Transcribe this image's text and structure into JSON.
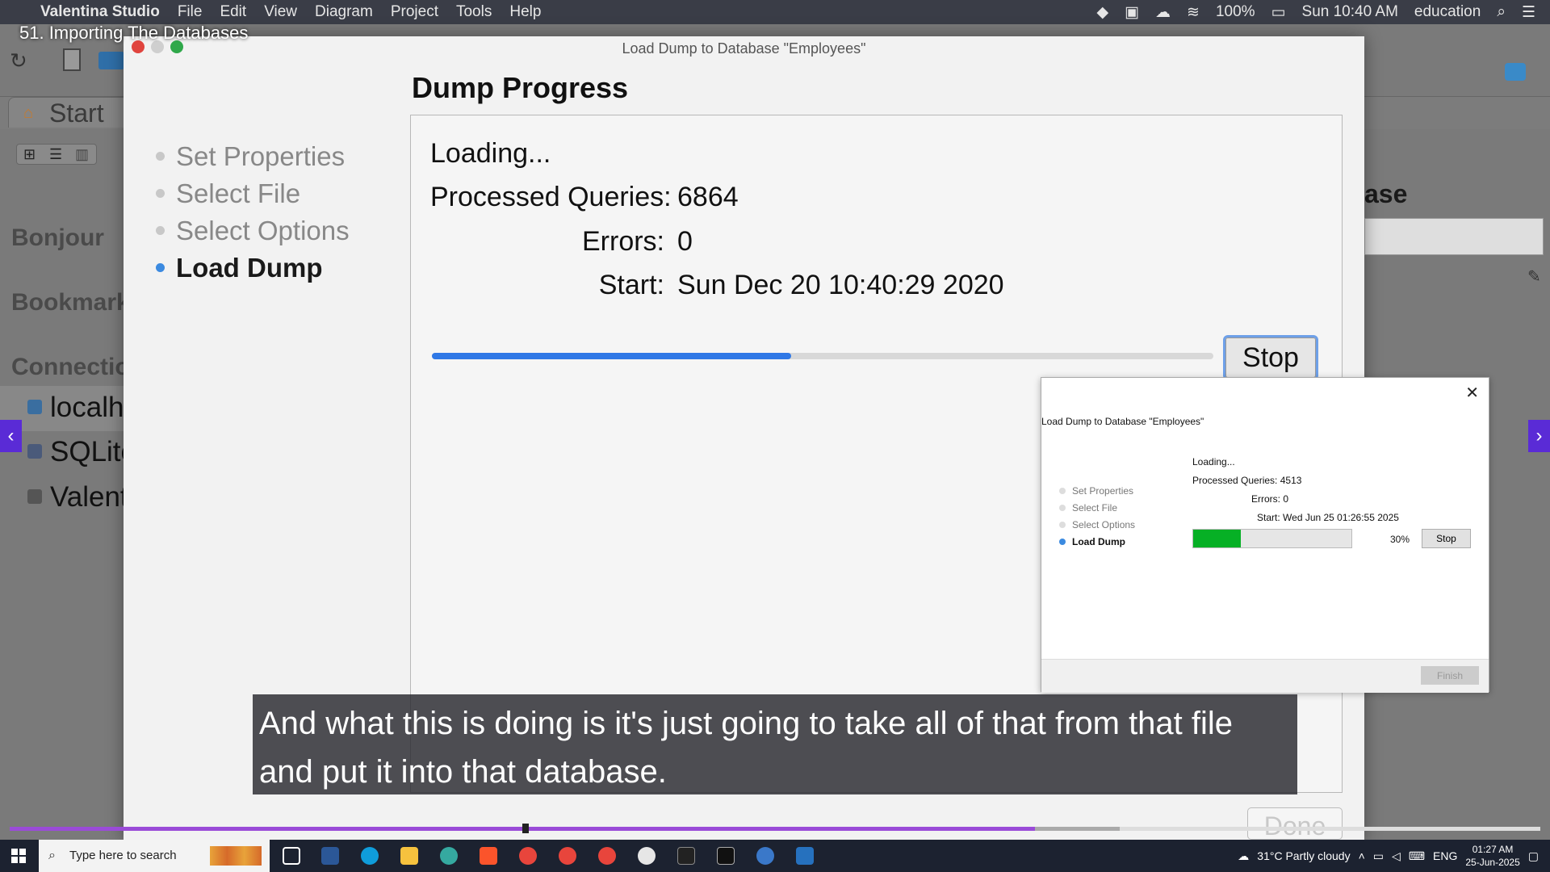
{
  "menubar": {
    "app_name": "Valentina Studio",
    "menus": [
      "File",
      "Edit",
      "View",
      "Diagram",
      "Project",
      "Tools",
      "Help"
    ],
    "battery": "100%",
    "clock": "Sun 10:40 AM",
    "user": "education"
  },
  "video": {
    "title": "51. Importing The Databases",
    "caption": "And what this is doing is it's just going to take all of that from that file and put it into that database.",
    "progress_played": 0.67,
    "progress_buffered": 0.725
  },
  "background_app": {
    "tab_label": "Start",
    "sidebar_headers": [
      "Bonjour",
      "Bookmarks",
      "Connections"
    ],
    "connections": [
      "localhost",
      "SQLite",
      "Valentina"
    ],
    "right_title": "ase"
  },
  "modal": {
    "title": "Load Dump to Database \"Employees\"",
    "heading": "Dump Progress",
    "steps": [
      "Set Properties",
      "Select File",
      "Select Options",
      "Load Dump"
    ],
    "active_step": 3,
    "status": "Loading...",
    "processed_label": "Processed Queries:",
    "processed_value": "6864",
    "errors_label": "Errors:",
    "errors_value": "0",
    "start_label": "Start:",
    "start_value": "Sun Dec 20 10:40:29 2020",
    "progress": 0.46,
    "stop_label": "Stop",
    "done_label": "Done"
  },
  "win_dialog": {
    "title": "Load Dump to Database \"Employees\"",
    "steps": [
      "Set Properties",
      "Select File",
      "Select Options",
      "Load Dump"
    ],
    "status": "Loading...",
    "processed_label": "Processed Queries:",
    "processed_value": "4513",
    "errors_label": "Errors:",
    "errors_value": "0",
    "start_label": "Start:",
    "start_value": "Wed Jun 25 01:26:55 2025",
    "progress": 0.3,
    "progress_text": "30%",
    "stop_label": "Stop",
    "finish_label": "Finish",
    "close_glyph": "✕"
  },
  "taskbar": {
    "search_placeholder": "Type here to search",
    "weather": "31°C  Partly cloudy",
    "lang": "ENG",
    "time": "01:27 AM",
    "date": "25-Jun-2025",
    "icons": [
      "task-view-icon",
      "word-icon",
      "edge-icon",
      "file-explorer-icon",
      "edge-dev-icon",
      "brave-icon",
      "chrome-icon",
      "chrome-profile-icon",
      "chrome-alt-icon",
      "slack-icon",
      "terminal-icon",
      "app-icon",
      "valentina-icon",
      "powershell-icon"
    ],
    "colors": {
      "task": "#ffffff",
      "word": "#2b5797",
      "edge": "#0f9ddb",
      "files": "#f6c23e",
      "edge-dev": "#35a9a0",
      "brave": "#fb542b",
      "chrome": "#e8453c",
      "chrome2": "#e8453c",
      "chrome3": "#e8453c",
      "slack": "#e6e6e6",
      "terminal": "#222222",
      "app": "#111111",
      "valentina": "#3a78c9",
      "ps": "#2671be"
    }
  }
}
